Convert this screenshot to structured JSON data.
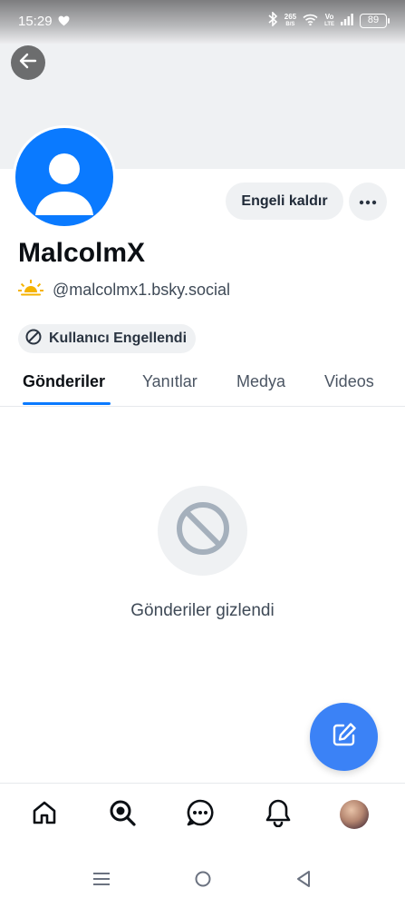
{
  "status_bar": {
    "time": "15:29",
    "netspeed_value": "265",
    "netspeed_unit": "B/S",
    "volte_top": "Vo",
    "volte_bottom": "LTE",
    "battery": "89"
  },
  "profile": {
    "display_name": "MalcolmX",
    "handle": "@malcolmx1.bsky.social",
    "unblock_label": "Engeli kaldır",
    "blocked_label": "Kullanıcı Engellendi",
    "accent_color": "#0a7aff"
  },
  "tabs": [
    {
      "label": "Gönderiler",
      "active": true
    },
    {
      "label": "Yanıtlar",
      "active": false
    },
    {
      "label": "Medya",
      "active": false
    },
    {
      "label": "Videos",
      "active": false
    }
  ],
  "empty_state": {
    "message": "Gönderiler gizlendi"
  },
  "bottom_nav": {
    "items": [
      "home-icon",
      "search-icon",
      "chat-icon",
      "bell-icon",
      "profile-avatar"
    ]
  }
}
